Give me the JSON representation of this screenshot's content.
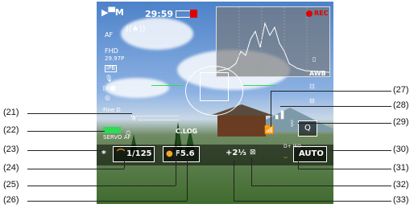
{
  "screen": {
    "rec_time": "29:59",
    "rec_label": "REC",
    "af_mode": "AF",
    "movie_size": "FHD",
    "frame_rate": "29.97P",
    "compression": "IPB",
    "wb": "AWB",
    "servo_af": "SERVO AF",
    "shutter": "1/125",
    "aperture": "F5.6",
    "exposure_comp": "+2⅓",
    "iso": "AUTO",
    "clog": "C.LOG",
    "picture_style": "Fine D",
    "magnify": "Q"
  },
  "callouts": {
    "left": [
      "(21)",
      "(22)",
      "(23)",
      "(24)",
      "(25)",
      "(26)"
    ],
    "right": [
      "(27)",
      "(28)",
      "(29)",
      "(30)",
      "(31)",
      "(32)",
      "(33)"
    ]
  },
  "colors": {
    "green_level": "#2bdc54",
    "orange": "#f5a623",
    "red": "#e00000"
  },
  "icons": [
    "movie-mode-icon",
    "battery-icon",
    "rec-dot-icon",
    "wifi-icon",
    "bluetooth-icon",
    "signal-icon",
    "magnify-icon",
    "histogram-icon",
    "asterisk-icon"
  ]
}
